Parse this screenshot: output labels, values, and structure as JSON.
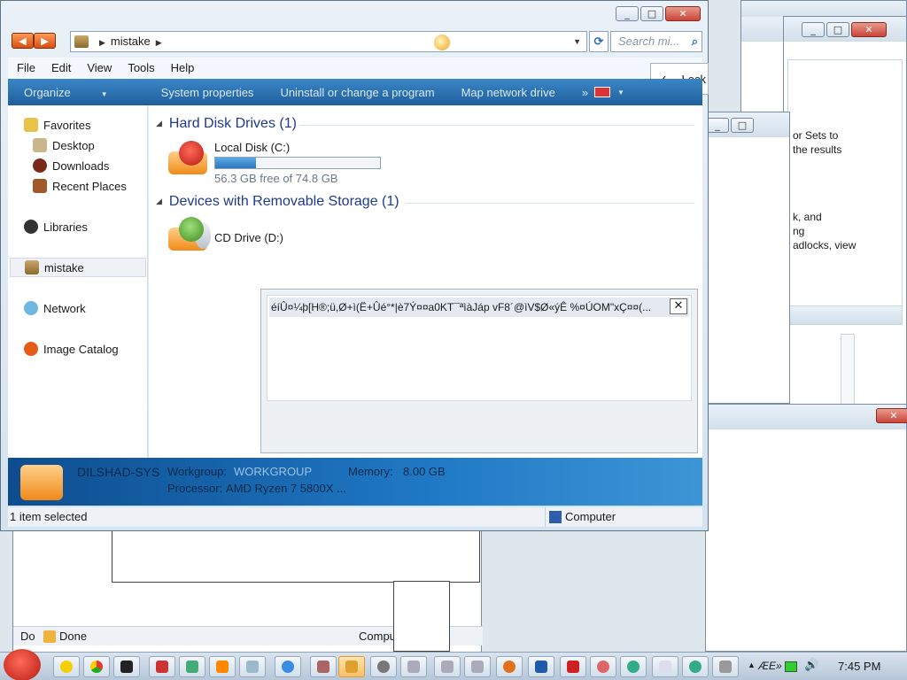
{
  "window": {
    "path_item": "mistake",
    "search_placeholder": "Search mi...",
    "menu": [
      "File",
      "Edit",
      "View",
      "Tools",
      "Help"
    ],
    "toolbar": [
      "Organize",
      "System properties",
      "Uninstall or change a program",
      "Map network drive",
      "»"
    ],
    "lock_label": "Lock"
  },
  "nav": {
    "favorites": "Favorites",
    "desktop": "Desktop",
    "downloads": "Downloads",
    "recent": "Recent Places",
    "libraries": "Libraries",
    "mistake": "mistake",
    "network": "Network",
    "image_catalog": "Image Catalog"
  },
  "content": {
    "group_hdd": "Hard Disk Drives (1)",
    "drive_c_name": "Local Disk (C:)",
    "drive_c_free": "56.3 GB free of 74.8 GB",
    "drive_c_used_fraction": 0.247,
    "group_removable": "Devices with Removable Storage (1)",
    "drive_d_name": "CD Drive (D:)"
  },
  "details": {
    "computer_name": "DILSHAD-SYS",
    "workgroup_label": "Workgroup:",
    "workgroup_value": "WORKGROUP",
    "memory_label": "Memory:",
    "memory_value": "8.00 GB",
    "processor_label": "Processor:",
    "processor_value": "AMD Ryzen 7 5800X ..."
  },
  "statusbar": {
    "left": "1 item selected",
    "right": "Computer"
  },
  "popup": {
    "title": "éíÛ¤¼þ[H®;ü,Ø+ì(Ë+Ûé°*|è7Ý¤¤a0KT¯ªìàJáp vF8´@ìV$Ø«ýÊ %¤ÚOM\"xÇ¤¤(..."
  },
  "background": {
    "text_lines": [
      "or Sets to",
      "the results",
      "k, and",
      "ng",
      "adlocks, view"
    ],
    "done_label": "Done",
    "computer_label": "Computer",
    "do_label": "Do"
  },
  "taskbar": {
    "time": "7:45 PM",
    "lang": "ÆE»"
  }
}
